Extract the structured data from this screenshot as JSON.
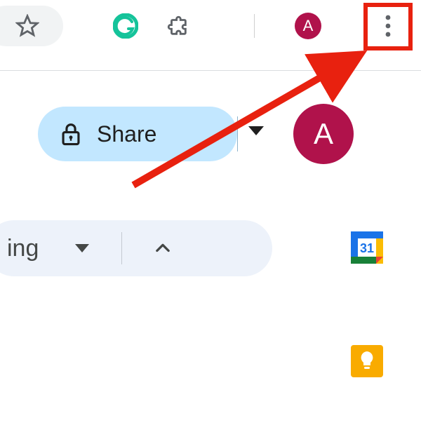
{
  "browser": {
    "profile_initial": "A",
    "bookmark_tooltip": "Bookmark this tab",
    "extensions_tooltip": "Extensions",
    "grammarly_tooltip": "Grammarly",
    "more_tooltip": "Customize and control Google Chrome"
  },
  "docs": {
    "share_label": "Share",
    "profile_initial": "A",
    "mode_label": "ing",
    "calendar_day": "31"
  },
  "colors": {
    "highlight": "#e8210f",
    "avatar_bg": "#b0124b",
    "share_bg": "#c2e7ff",
    "pill_bg": "#edf2fa",
    "keep_bg": "#f9ab00"
  }
}
